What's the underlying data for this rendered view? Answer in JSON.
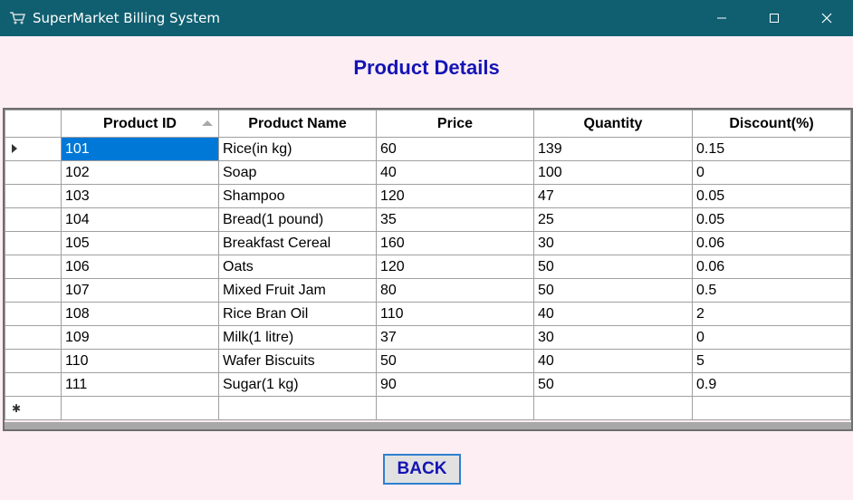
{
  "window": {
    "title": "SuperMarket Billing System"
  },
  "heading": "Product Details",
  "table": {
    "columns": [
      "Product ID",
      "Product Name",
      "Price",
      "Quantity",
      "Discount(%)"
    ],
    "sorted_column": "Product ID",
    "selected_row": 0,
    "rows": [
      [
        "101",
        "Rice(in kg)",
        "60",
        "139",
        "0.15"
      ],
      [
        "102",
        "Soap",
        "40",
        "100",
        "0"
      ],
      [
        "103",
        "Shampoo",
        "120",
        "47",
        "0.05"
      ],
      [
        "104",
        "Bread(1 pound)",
        "35",
        "25",
        "0.05"
      ],
      [
        "105",
        "Breakfast Cereal",
        "160",
        "30",
        "0.06"
      ],
      [
        "106",
        "Oats",
        "120",
        "50",
        "0.06"
      ],
      [
        "107",
        "Mixed Fruit Jam",
        "80",
        "50",
        "0.5"
      ],
      [
        "108",
        "Rice Bran Oil",
        "110",
        "40",
        "2"
      ],
      [
        "109",
        "Milk(1 litre)",
        "37",
        "30",
        "0"
      ],
      [
        "110",
        "Wafer Biscuits",
        "50",
        "40",
        "5"
      ],
      [
        "111",
        "Sugar(1 kg)",
        "90",
        "50",
        "0.9"
      ]
    ]
  },
  "back_button": {
    "label": "BACK"
  },
  "colors": {
    "titlebar": "#0f5f70",
    "background": "#fdeef4",
    "heading": "#1414b4",
    "selection": "#0078d7"
  }
}
